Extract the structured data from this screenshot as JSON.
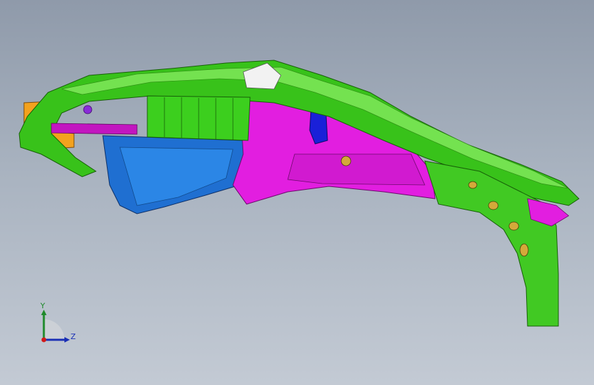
{
  "viewport": {
    "background_top": "#8f9aaa",
    "background_bottom": "#c3cad4"
  },
  "model": {
    "part_colors": {
      "upper_rail": "#38c21a",
      "upper_rail_highlight": "#7fe85a",
      "inner_panel": "#e21ee0",
      "wheelhouse": "#1f6fd1",
      "bracket_orange": "#f3a21e",
      "bracket_dark_blue": "#1a20d8",
      "pillar_green": "#41c923"
    }
  },
  "triad": {
    "y_label": "Y",
    "z_label": "Z",
    "y_color": "#1f8a2b",
    "z_color": "#1a2fb5",
    "origin_color": "#d11a1a"
  }
}
